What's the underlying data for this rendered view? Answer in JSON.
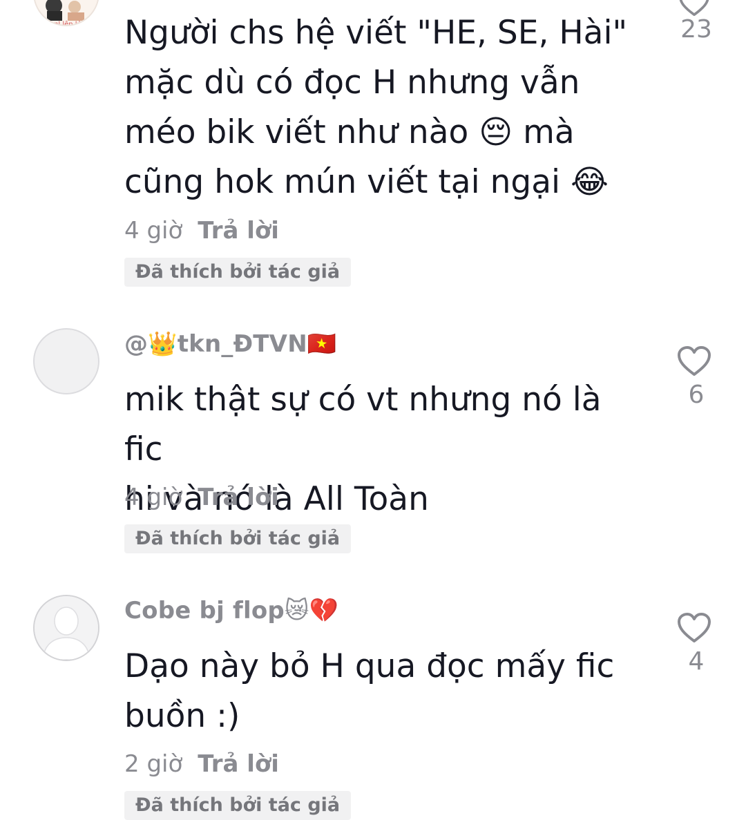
{
  "comments": [
    {
      "username": "",
      "avatar_text": "nl lên lử",
      "text": "Người chs hệ viết \"HE, SE, Hài\"\nmặc dù có đọc H nhưng vẫn\nméo bik viết như nào 😔 mà\ncũng hok mún viết tại ngại 😂",
      "time": "4 giờ",
      "reply": "Trả lời",
      "liked_badge": "Đã thích bởi tác giả",
      "likes": "23"
    },
    {
      "username": "@👑tkn_ĐTVN🇻🇳",
      "text": "mik thật sự có vt nhưng nó là fic\nhi và nó là All Toàn",
      "time": "4 giờ",
      "reply": "Trả lời",
      "liked_badge": "Đã thích bởi tác giả",
      "likes": "6"
    },
    {
      "username": "Cobe bj flop😿💔",
      "text": "Dạo này bỏ H qua đọc mấy fic\nbuồn :)",
      "time": "2 giờ",
      "reply": "Trả lời",
      "liked_badge": "Đã thích bởi tác giả",
      "likes": "4"
    }
  ],
  "icons": {
    "like": "heart-outline-icon",
    "default_avatar": "person-silhouette-icon"
  },
  "colors": {
    "text_primary": "#161823",
    "text_secondary": "#8a8b91",
    "badge_bg": "#f1f1f2"
  }
}
